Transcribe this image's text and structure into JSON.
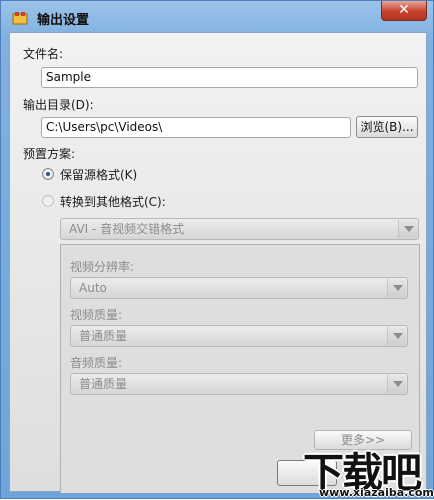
{
  "window": {
    "title": "输出设置",
    "close_label": "✕"
  },
  "form": {
    "filename_label": "文件名:",
    "filename_value": "Sample",
    "outdir_label": "输出目录(D):",
    "outdir_value": "C:\\Users\\pc\\Videos\\",
    "browse_label": "浏览(B)...",
    "preset_label": "预置方案:",
    "keep_format_label": "保留源格式(K)",
    "convert_label": "转换到其他格式(C):",
    "format_value": "AVI - 音视频交错格式"
  },
  "panel": {
    "resolution_label": "视频分辨率:",
    "resolution_value": "Auto",
    "video_quality_label": "视频质量:",
    "video_quality_value": "普通质量",
    "audio_quality_label": "音频质量:",
    "audio_quality_value": "普通质量",
    "more_label": "更多>>"
  },
  "watermark": {
    "brand": "下载吧",
    "url": "www.xiazaiba.com"
  },
  "colors": {
    "titlebar": "#8ab8e6",
    "close_button": "#c8422e",
    "radio_checked": "#2f4f8a"
  }
}
